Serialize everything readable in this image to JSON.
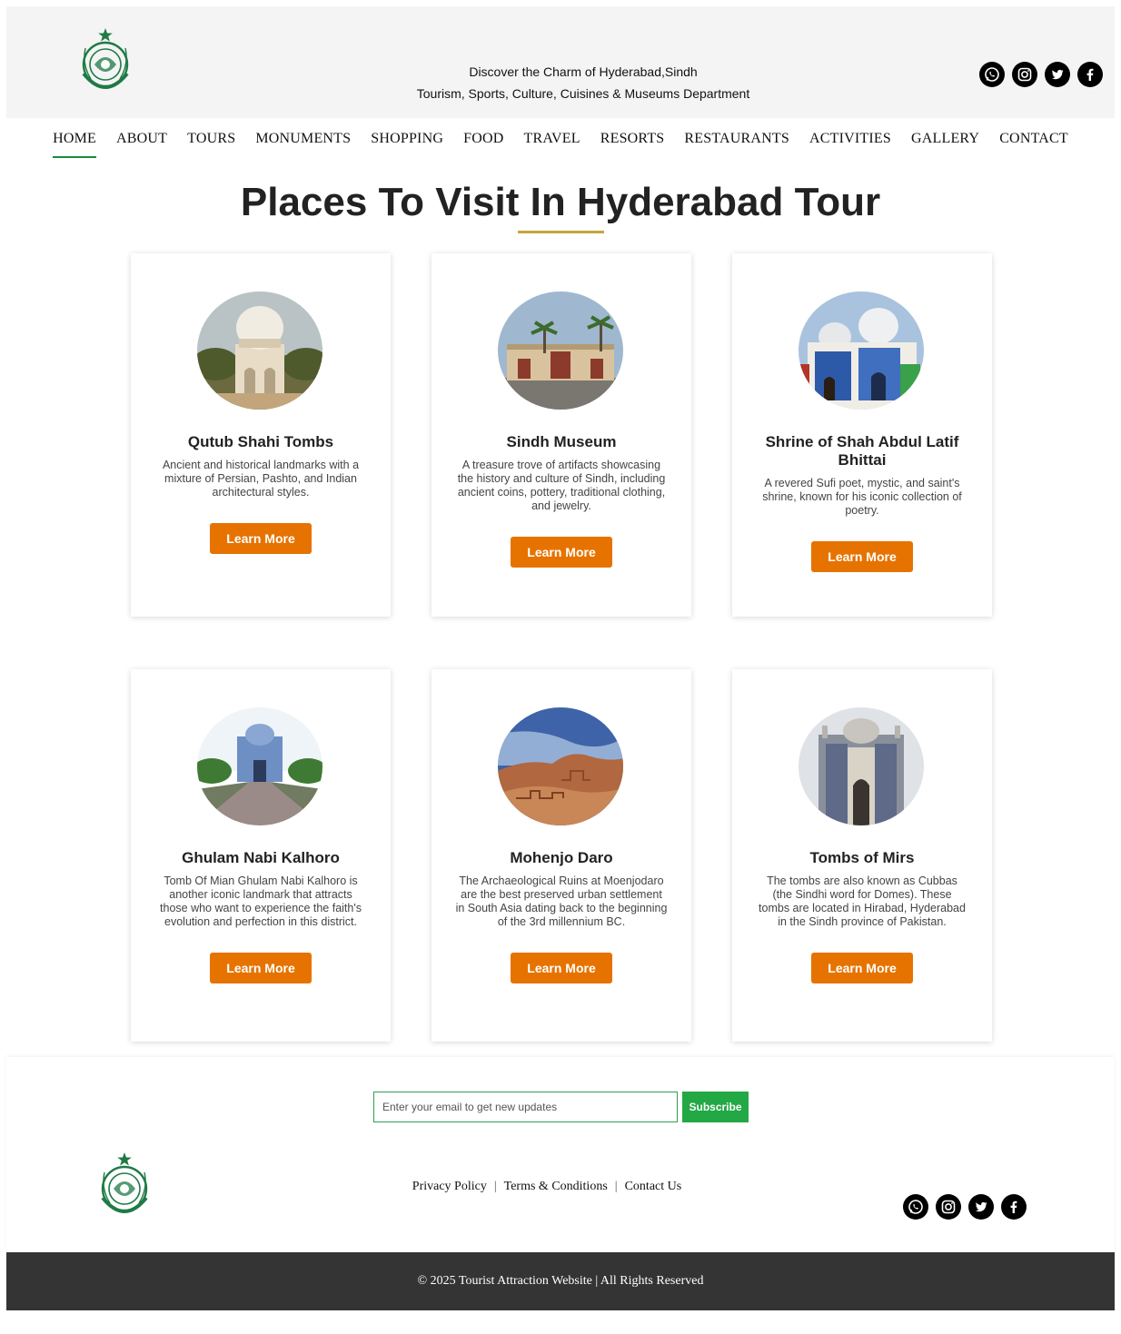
{
  "header": {
    "tagline_line1": "Discover the Charm of Hyderabad,Sindh",
    "tagline_line2": "Tourism, Sports, Culture, Cuisines & Museums Department",
    "logo_icon": "sindh-government-emblem",
    "social_icons": [
      "whatsapp-icon",
      "instagram-icon",
      "twitter-icon",
      "facebook-icon"
    ]
  },
  "nav": {
    "items": [
      "HOME",
      "ABOUT",
      "TOURS",
      "MONUMENTS",
      "SHOPPING",
      "FOOD",
      "TRAVEL",
      "RESORTS",
      "RESTAURANTS",
      "ACTIVITIES",
      "GALLERY",
      "CONTACT"
    ],
    "active": "HOME"
  },
  "main": {
    "title": "Places To Visit In Hyderabad Tour",
    "cards": [
      {
        "name": "Qutub Shahi Tombs",
        "description": "Ancient and historical landmarks with a mixture of Persian, Pashto, and Indian architectural styles.",
        "button": "Learn More"
      },
      {
        "name": "Sindh Museum",
        "description": "A treasure trove of artifacts showcasing the history and culture of Sindh, including ancient coins, pottery, traditional clothing, and jewelry.",
        "button": "Learn More"
      },
      {
        "name": "Shrine of Shah Abdul Latif Bhittai",
        "description": "A revered Sufi poet, mystic, and saint's shrine, known for his iconic collection of poetry.",
        "button": "Learn More"
      },
      {
        "name": "Ghulam Nabi Kalhoro",
        "description": "Tomb Of Mian Ghulam Nabi Kalhoro is another iconic landmark that attracts those who want to experience the faith's evolution and perfection in this district.",
        "button": "Learn More"
      },
      {
        "name": "Mohenjo Daro",
        "description": "The Archaeological Ruins at Moenjodaro are the best preserved urban settlement in South Asia dating back to the beginning of the 3rd millennium BC.",
        "button": "Learn More"
      },
      {
        "name": "Tombs of Mirs",
        "description": "The tombs are also known as Cubbas (the Sindhi word for Domes). These tombs are located in Hirabad, Hyderabad in the Sindh province of Pakistan.",
        "button": "Learn More"
      }
    ]
  },
  "newsletter": {
    "placeholder": "Enter your email to get new updates",
    "button": "Subscribe"
  },
  "footer": {
    "links": [
      "Privacy Policy",
      "Terms & Conditions",
      "Contact Us"
    ],
    "copyright": "© 2025 Tourist Attraction Website | All Rights Reserved"
  },
  "colors": {
    "accent_orange": "#e67300",
    "nav_active_green": "#1a8b3c",
    "title_underline_gold": "#c8a43a",
    "subscribe_green": "#22a845",
    "copyright_bar": "#343434"
  }
}
